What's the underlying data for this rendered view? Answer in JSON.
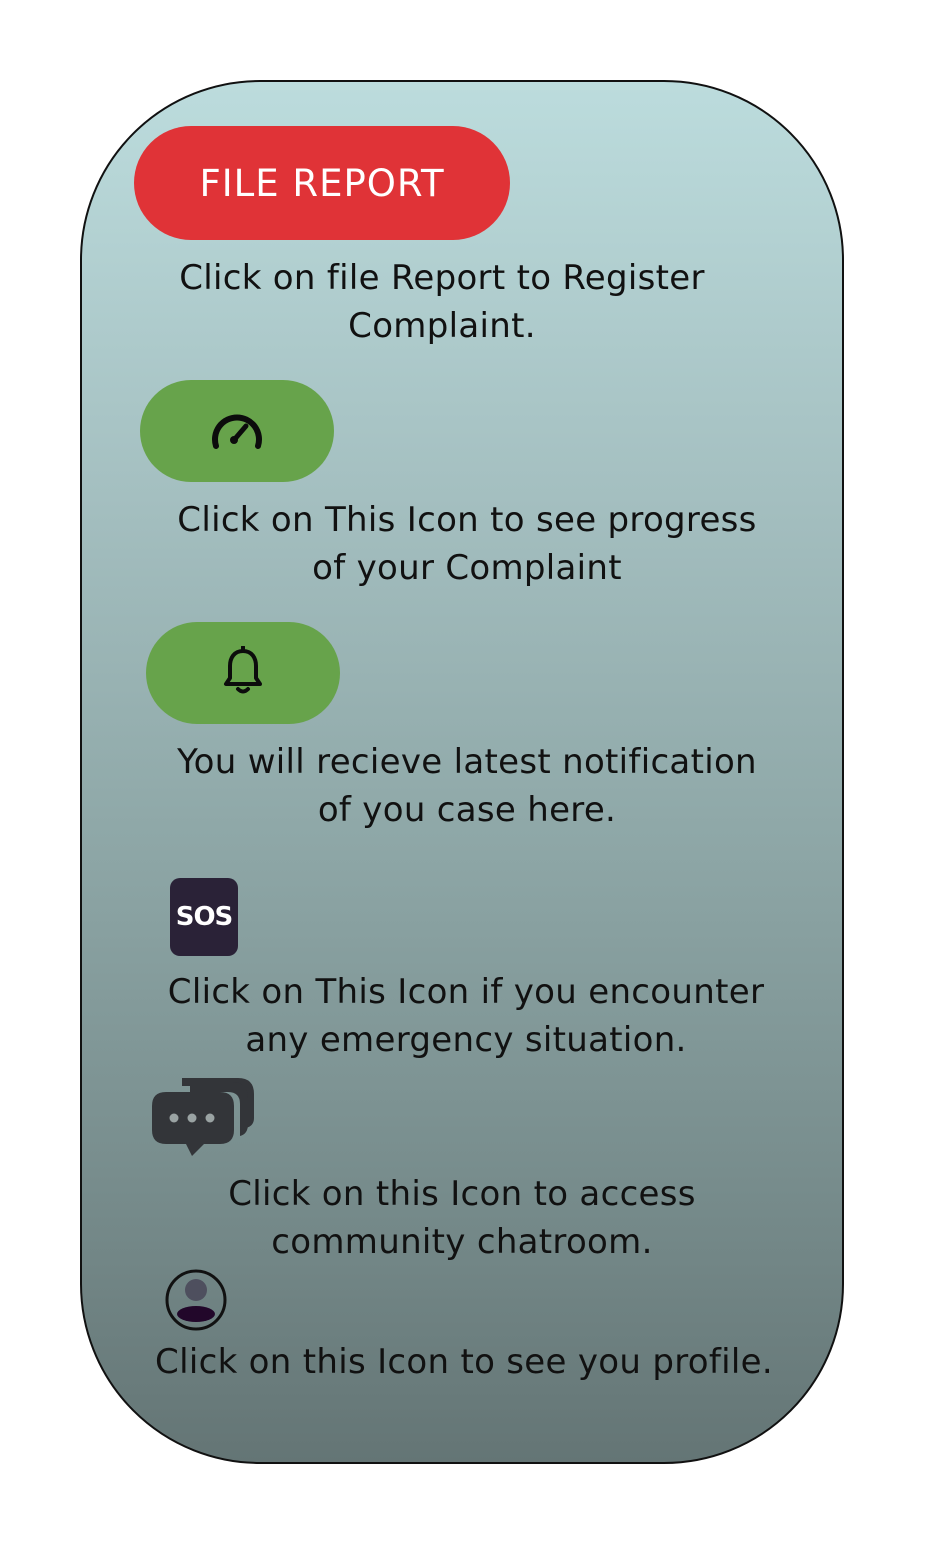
{
  "file_report": {
    "label": "FILE REPORT",
    "description": "Click on file Report to Register\nComplaint.",
    "color": "#e03337"
  },
  "progress": {
    "icon": "speedometer-icon",
    "description": "Click on This Icon to see progress\nof your Complaint",
    "color": "#67a34b"
  },
  "notifications": {
    "icon": "bell-icon",
    "description": "You will recieve latest notification\nof you case here.",
    "color": "#67a34b"
  },
  "sos": {
    "label": "SOS",
    "description": "Click on This Icon  if you encounter\nany emergency situation.",
    "color": "#2a2237"
  },
  "chatroom": {
    "icon": "chat-bubbles-icon",
    "description": "Click on this Icon to access\ncommunity chatroom."
  },
  "profile": {
    "icon": "profile-avatar-icon",
    "description": "Click on this Icon to see you profile."
  }
}
